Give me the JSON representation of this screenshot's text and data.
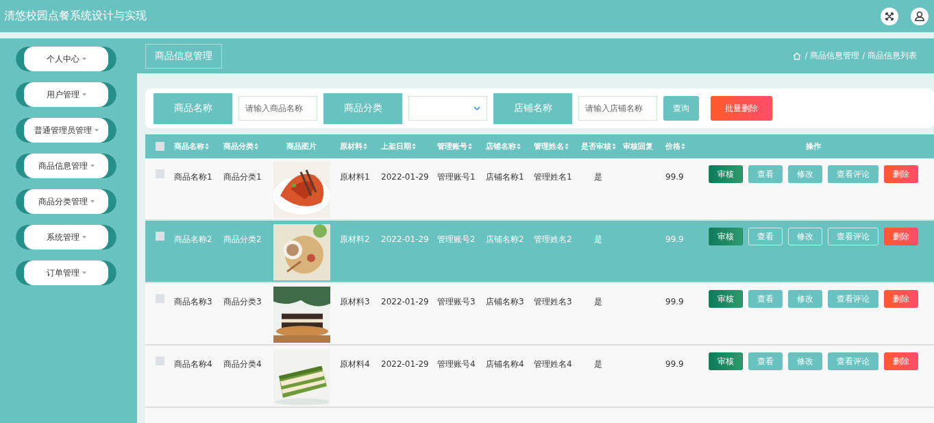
{
  "app": {
    "title": "清悠校园点餐系统设计与实现"
  },
  "sidebar": {
    "items": [
      {
        "label": "个人中心"
      },
      {
        "label": "用户管理"
      },
      {
        "label": "普通管理员管理"
      },
      {
        "label": "商品信息管理"
      },
      {
        "label": "商品分类管理"
      },
      {
        "label": "系统管理"
      },
      {
        "label": "订单管理"
      }
    ]
  },
  "page_tab": {
    "label": "商品信息管理"
  },
  "breadcrumb": "/ 商品信息管理 / 商品信息列表",
  "search": {
    "filters": [
      {
        "label": "商品名称",
        "kind": "input",
        "placeholder": "请输入商品名称"
      },
      {
        "label": "商品分类",
        "kind": "select"
      },
      {
        "label": "店铺名称",
        "kind": "input",
        "placeholder": "请输入店铺名称"
      }
    ],
    "buttons": [
      {
        "label": "查询",
        "kind": "primary"
      },
      {
        "label": "批量删除",
        "kind": "danger"
      }
    ]
  },
  "table": {
    "all_checked": false,
    "columns": [
      {
        "label": "商品名称",
        "sortable": true
      },
      {
        "label": "商品分类",
        "sortable": true
      },
      {
        "label": "商品图片",
        "sortable": false
      },
      {
        "label": "原材料",
        "sortable": true
      },
      {
        "label": "上架日期",
        "sortable": true
      },
      {
        "label": "管理账号",
        "sortable": true
      },
      {
        "label": "店铺名称",
        "sortable": true
      },
      {
        "label": "管理姓名",
        "sortable": true
      },
      {
        "label": "是否审核",
        "sortable": true
      },
      {
        "label": "审核回复",
        "sortable": false
      },
      {
        "label": "价格",
        "sortable": true
      },
      {
        "label": "操作",
        "sortable": false
      }
    ],
    "rows": [
      {
        "selected": false,
        "checked": false,
        "name": "商品名称1",
        "category": "商品分类1",
        "material": "原材料1",
        "date": "2022-01-29",
        "account": "管理账号1",
        "shop": "店铺名称1",
        "manager": "管理姓名1",
        "audited": "是",
        "price": "99.9",
        "actions": [
          {
            "label": "审核",
            "kind": "success"
          },
          {
            "label": "查看",
            "kind": "default"
          },
          {
            "label": "修改",
            "kind": "default"
          },
          {
            "label": "查看评论",
            "kind": "default"
          },
          {
            "label": "删除",
            "kind": "danger"
          }
        ]
      },
      {
        "selected": true,
        "checked": false,
        "name": "商品名称2",
        "category": "商品分类2",
        "material": "原材料2",
        "date": "2022-01-29",
        "account": "管理账号2",
        "shop": "店铺名称2",
        "manager": "管理姓名2",
        "audited": "是",
        "price": "99.9",
        "actions": [
          {
            "label": "审核",
            "kind": "success"
          },
          {
            "label": "查看",
            "kind": "default"
          },
          {
            "label": "修改",
            "kind": "default"
          },
          {
            "label": "查看评论",
            "kind": "default"
          },
          {
            "label": "删除",
            "kind": "danger"
          }
        ]
      },
      {
        "selected": false,
        "checked": false,
        "name": "商品名称3",
        "category": "商品分类3",
        "material": "原材料3",
        "date": "2022-01-29",
        "account": "管理账号3",
        "shop": "店铺名称3",
        "manager": "管理姓名3",
        "audited": "是",
        "price": "99.9",
        "actions": [
          {
            "label": "审核",
            "kind": "success"
          },
          {
            "label": "查看",
            "kind": "default"
          },
          {
            "label": "修改",
            "kind": "default"
          },
          {
            "label": "查看评论",
            "kind": "default"
          },
          {
            "label": "删除",
            "kind": "danger"
          }
        ]
      },
      {
        "selected": false,
        "checked": false,
        "name": "商品名称4",
        "category": "商品分类4",
        "material": "原材料4",
        "date": "2022-01-29",
        "account": "管理账号4",
        "shop": "店铺名称4",
        "manager": "管理姓名4",
        "audited": "是",
        "price": "99.9",
        "actions": [
          {
            "label": "审核",
            "kind": "success"
          },
          {
            "label": "查看",
            "kind": "default"
          },
          {
            "label": "修改",
            "kind": "default"
          },
          {
            "label": "查看评论",
            "kind": "default"
          },
          {
            "label": "删除",
            "kind": "danger"
          }
        ]
      }
    ]
  }
}
